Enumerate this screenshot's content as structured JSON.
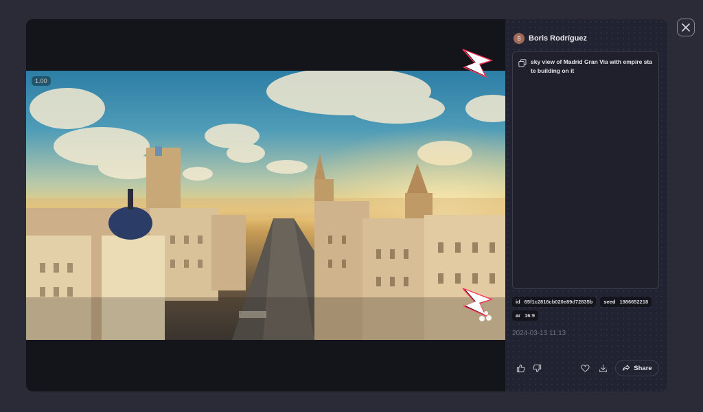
{
  "modal": {
    "close_icon": "close-icon"
  },
  "viewer": {
    "zoom_label": "1.00",
    "watermark_icon": "lightning-logo-icon"
  },
  "sidebar": {
    "author": {
      "initial": "B",
      "name": "Boris Rodríguez"
    },
    "prompt": {
      "copy_icon": "copy-icon",
      "text": "sky view of Madrid Gran Via with empire state building on it"
    },
    "meta": {
      "id_label": "id",
      "id_value": "65f1c2816cb020e89d72835b",
      "seed_label": "seed",
      "seed_value": "1986652218",
      "ar_label": "ar",
      "ar_value": "16:9"
    },
    "created_at": "2024-03-13 11:13",
    "actions": {
      "like_icon": "thumbs-up-icon",
      "dislike_icon": "thumbs-down-icon",
      "favorite_icon": "heart-icon",
      "download_icon": "download-icon",
      "share_icon": "share-icon",
      "share_label": "Share"
    }
  },
  "colors": {
    "backdrop": "#2a2b36",
    "panel": "#222330",
    "viewer_bg": "#14141b",
    "text": "#e8e8ee",
    "muted": "#6f7184"
  }
}
